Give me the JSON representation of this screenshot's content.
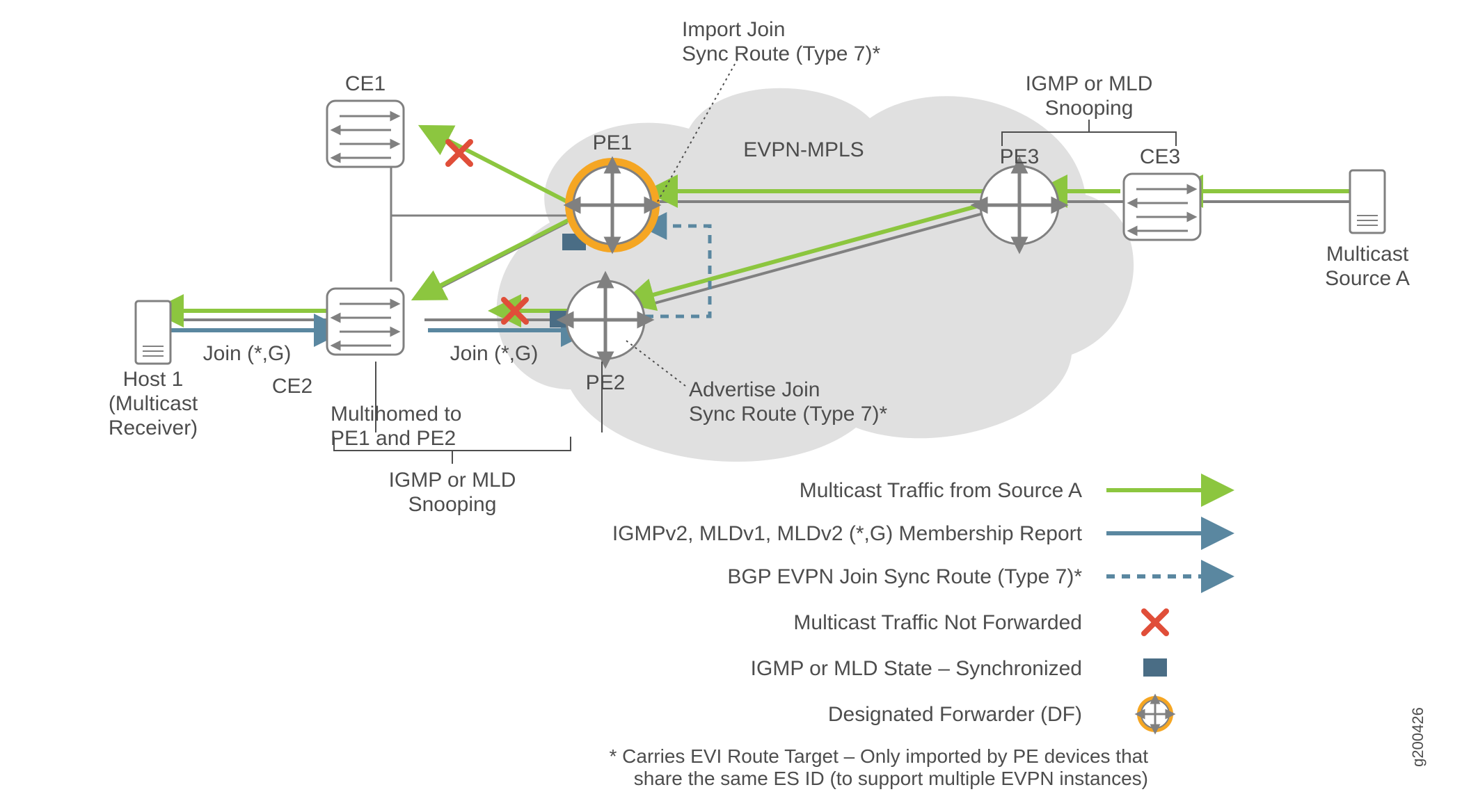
{
  "labels": {
    "host1_l1": "Host 1",
    "host1_l2": "(Multicast",
    "host1_l3": "Receiver)",
    "ce1": "CE1",
    "ce2": "CE2",
    "ce3": "CE3",
    "pe1": "PE1",
    "pe2": "PE2",
    "pe3": "PE3",
    "source_l1": "Multicast",
    "source_l2": "Source A",
    "join_sg_1": "Join (*,G)",
    "join_sg_2": "Join (*,G)",
    "multihomed_l1": "Multihomed to",
    "multihomed_l2": "PE1 and PE2",
    "snooping_left_l1": "IGMP or MLD",
    "snooping_left_l2": "Snooping",
    "snooping_right_l1": "IGMP or MLD",
    "snooping_right_l2": "Snooping",
    "import_l1": "Import Join",
    "import_l2": "Sync Route (Type 7)*",
    "advertise_l1": "Advertise Join",
    "advertise_l2": "Sync Route (Type 7)*",
    "evpn_mpls": "EVPN-MPLS",
    "figure_id": "g200426"
  },
  "legend": {
    "traffic": "Multicast Traffic from Source A",
    "membership": "IGMPv2, MLDv1, MLDv2  (*,G) Membership Report",
    "sync_route": "BGP EVPN Join Sync Route (Type 7)*",
    "not_forwarded": "Multicast Traffic Not Forwarded",
    "state_sync": "IGMP or MLD State – Synchronized",
    "df": "Designated Forwarder (DF)",
    "footnote_l1": "* Carries EVI Route Target – Only imported by PE devices that",
    "footnote_l2": "share the same ES ID (to support multiple EVPN instances)"
  },
  "colors": {
    "green": "#8cc63f",
    "blue": "#5a87a0",
    "red": "#e04e39",
    "orange": "#f5a623",
    "gray_stroke": "#808080",
    "gray_fill": "#b3b3b3",
    "cloud": "#e0e0e0",
    "text": "#4d4d4d",
    "green_text": "#7aa93f",
    "state_blue": "#4a6d85"
  }
}
